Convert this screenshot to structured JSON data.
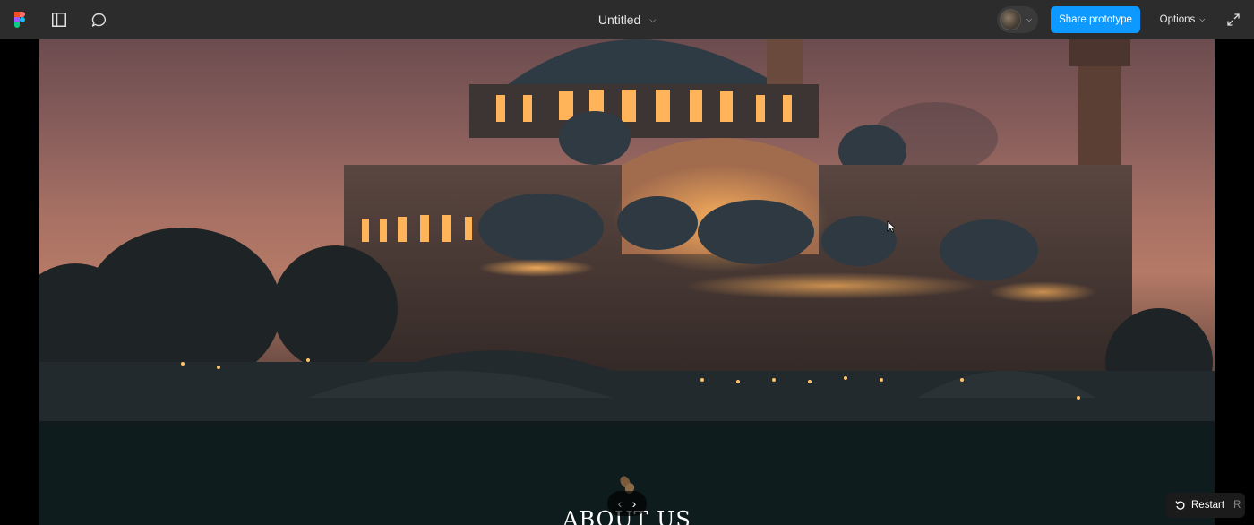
{
  "app": {
    "title": "Untitled",
    "share_label": "Share prototype",
    "options_label": "Options",
    "restart_label": "Restart",
    "restart_shortcut": "R",
    "accent": "#0d99ff"
  },
  "toolbar_icons": [
    "figma-logo-icon",
    "sidebar-toggle-icon",
    "comment-icon"
  ],
  "frame": {
    "section_title": "ABOUT US",
    "hero_image": "mosque-at-dusk"
  }
}
